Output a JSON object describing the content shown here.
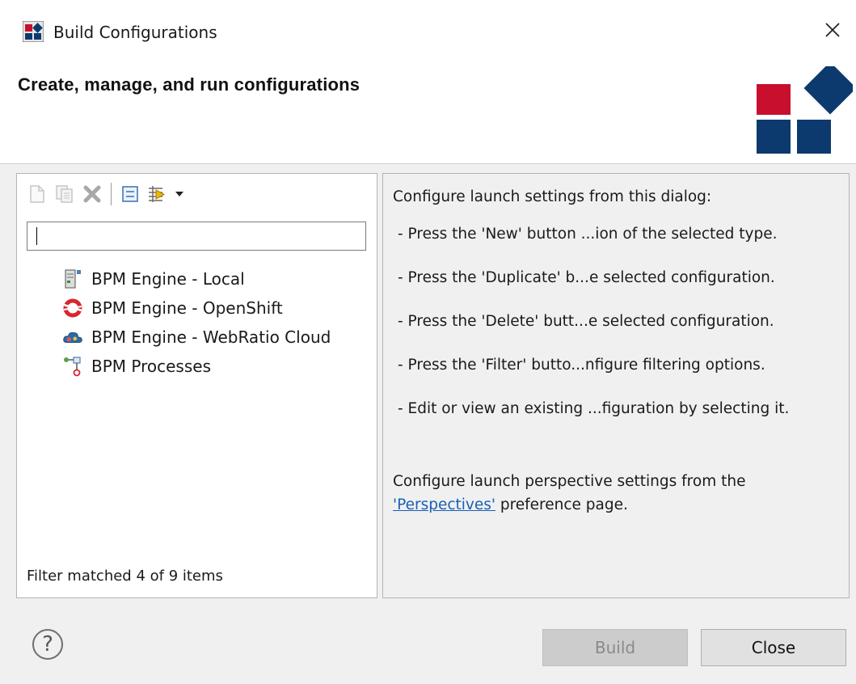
{
  "window": {
    "title": "Build Configurations",
    "header_title": "Create, manage, and run configurations"
  },
  "toolbar": {
    "buttons": [
      {
        "icon": "new-config-icon",
        "enabled": false
      },
      {
        "icon": "duplicate-icon",
        "enabled": false
      },
      {
        "icon": "delete-icon",
        "enabled": false
      },
      {
        "icon": "collapse-all-icon",
        "enabled": true
      },
      {
        "icon": "filter-icon",
        "enabled": true
      },
      {
        "icon": "dropdown-arrow-icon",
        "enabled": true
      }
    ]
  },
  "filter": {
    "value": "",
    "status": "Filter matched 4 of 9 items"
  },
  "tree": {
    "items": [
      {
        "label": "BPM Engine - Local",
        "icon": "local-server-icon"
      },
      {
        "label": "BPM Engine - OpenShift",
        "icon": "openshift-icon"
      },
      {
        "label": "BPM Engine - WebRatio Cloud",
        "icon": "cloud-icon"
      },
      {
        "label": "BPM Processes",
        "icon": "process-icon"
      }
    ]
  },
  "info": {
    "intro": "Configure launch settings from this dialog:",
    "bullets": [
      "- Press the 'New' button ...ion of the selected type.",
      "- Press the 'Duplicate' b...e selected configuration.",
      "- Press the 'Delete' butt...e selected configuration.",
      "- Press the 'Filter' butto...nfigure filtering options.",
      "- Edit or view an existing ...figuration by selecting it."
    ],
    "perspectives_prefix": "Configure launch perspective settings from the",
    "perspectives_link": "'Perspectives'",
    "perspectives_suffix": " preference page."
  },
  "buttons": {
    "help": "?",
    "build": "Build",
    "close": "Close"
  },
  "colors": {
    "logo_red": "#c8102e",
    "logo_blue": "#0d3a6e",
    "link": "#1a5fb4"
  }
}
